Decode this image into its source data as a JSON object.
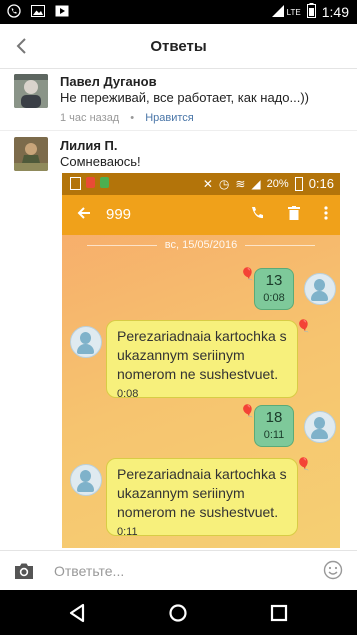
{
  "status_bar": {
    "time": "1:49",
    "network": "LTE"
  },
  "header": {
    "title": "Ответы"
  },
  "comments": [
    {
      "author": "Павел Дуганов",
      "text": "Не переживай, все работает, как надо...))",
      "time": "1 час назад",
      "separator": "•",
      "like_label": "Нравится"
    },
    {
      "author": "Лилия П.",
      "text": "Сомневаюсь!"
    }
  ],
  "attached_screenshot": {
    "status_battery": "20%",
    "status_time": "0:16",
    "contact": "999",
    "date": "вс, 15/05/2016",
    "messages": [
      {
        "dir": "out",
        "text": "13",
        "time": "0:08"
      },
      {
        "dir": "in",
        "lines": [
          "Perezariadnaia kartochka s",
          "ukazannym seriinym",
          "nomerom ne sushestvuet."
        ],
        "time": "0:08"
      },
      {
        "dir": "out",
        "text": "18",
        "time": "0:11"
      },
      {
        "dir": "in",
        "lines": [
          "Perezariadnaia kartochka s",
          "ukazannym seriinym",
          "nomerom ne sushestvuet."
        ],
        "time": "0:11"
      }
    ]
  },
  "composer": {
    "placeholder": "Ответьте..."
  },
  "colors": {
    "accent": "#4a76a8",
    "phone_bar": "#f0a11a",
    "sent_bubble": "#7ec99a",
    "received_bubble": "#f7f07c"
  }
}
